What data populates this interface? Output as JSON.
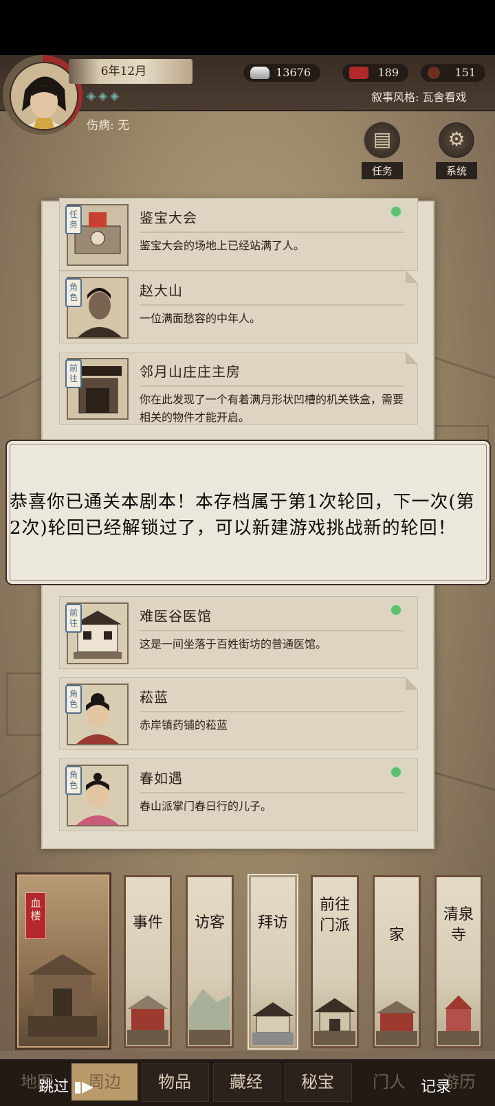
{
  "header": {
    "date": "6年12月",
    "diamonds": "◈◈◈",
    "injury_label": "伤病: 无",
    "silver": "13676",
    "flag_count": "189",
    "coin_count": "151",
    "narrative_style": "叙事风格: 瓦舍看戏"
  },
  "side_buttons": {
    "task": "任务",
    "system": "系统"
  },
  "cards": [
    {
      "tag": "任务",
      "title": "鉴宝大会",
      "desc": "鉴宝大会的场地上已经站满了人。",
      "dot": true
    },
    {
      "tag": "角色",
      "title": "赵大山",
      "desc": "一位满面愁容的中年人。",
      "dot": false
    },
    {
      "tag": "前往",
      "title": "邻月山庄庄主房",
      "desc": "你在此发现了一个有着满月形状凹槽的机关铁盒，需要相关的物件才能开启。",
      "dot": false
    },
    {
      "tag": "前往",
      "title": "难医谷医馆",
      "desc": "这是一间坐落于百姓街坊的普通医馆。",
      "dot": true
    },
    {
      "tag": "角色",
      "title": "菘蓝",
      "desc": "赤岸镇药铺的菘蓝",
      "dot": false
    },
    {
      "tag": "角色",
      "title": "春如遇",
      "desc": "春山派掌门春日行的儿子。",
      "dot": true
    }
  ],
  "dialog": {
    "message": "恭喜你已通关本剧本！本存档属于第1次轮回，下一次(第2次)轮回已经解锁过了，可以新建游戏挑战新的轮回！"
  },
  "locations": {
    "current_badge": "血楼",
    "items": [
      "事件",
      "访客",
      "拜访",
      "前往门派",
      "家",
      "清泉寺"
    ]
  },
  "nav": {
    "items": [
      "地图",
      "周边",
      "物品",
      "藏经",
      "秘宝",
      "门人",
      "游历"
    ],
    "skip": "跳过 ▮▶",
    "record": "记录"
  }
}
